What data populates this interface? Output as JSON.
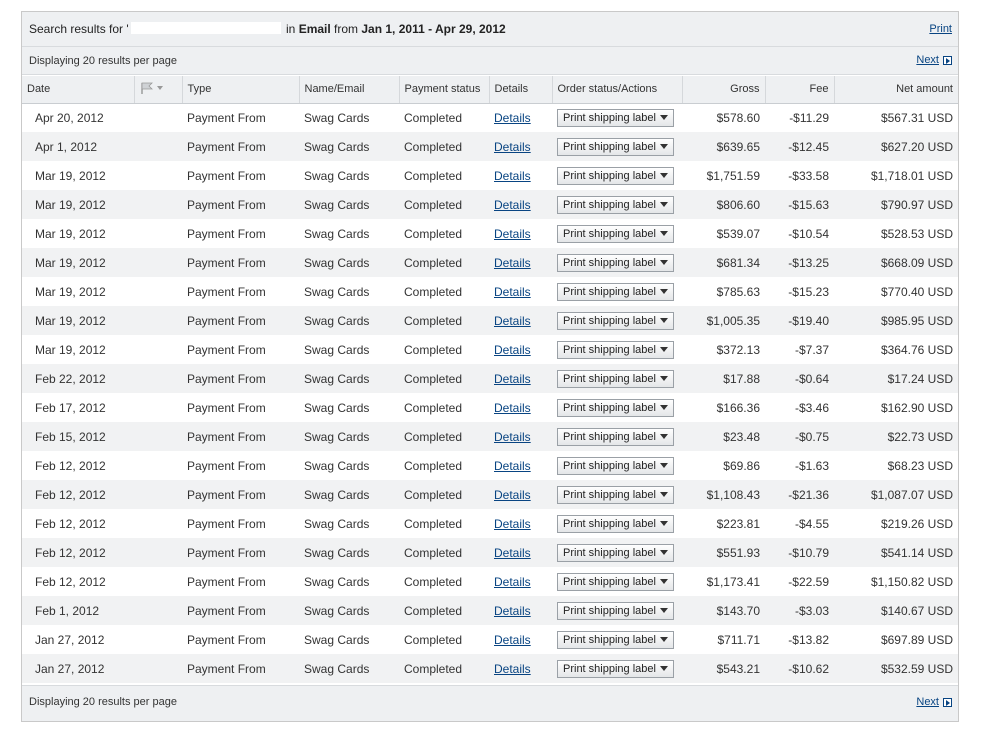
{
  "search": {
    "prefix": "Search results for '",
    "in_text": " in ",
    "field": "Email",
    "from_text": " from ",
    "date_range": "Jan 1, 2011 - Apr 29, 2012"
  },
  "header": {
    "print_label": "Print"
  },
  "pager": {
    "display_text": "Displaying 20 results per page",
    "next_label": "Next"
  },
  "columns": {
    "date": "Date",
    "type": "Type",
    "name_email": "Name/Email",
    "payment_status": "Payment status",
    "details": "Details",
    "order_status": "Order status/Actions",
    "gross": "Gross",
    "fee": "Fee",
    "net": "Net amount"
  },
  "colors": {
    "link": "#084482",
    "header_bg": "#eef0f2",
    "row_alt": "#f1f2f3"
  },
  "icons": {
    "flag_filter": "flag-icon",
    "dropdown": "chevron-down-icon",
    "next": "next-arrow-icon"
  },
  "rows": [
    {
      "date": "Apr 20, 2012",
      "type": "Payment From",
      "name": "Swag Cards",
      "status": "Completed",
      "details": "Details",
      "action": "Print shipping label",
      "gross": "$578.60",
      "fee": "-$11.29",
      "net": "$567.31 USD"
    },
    {
      "date": "Apr 1, 2012",
      "type": "Payment From",
      "name": "Swag Cards",
      "status": "Completed",
      "details": "Details",
      "action": "Print shipping label",
      "gross": "$639.65",
      "fee": "-$12.45",
      "net": "$627.20 USD"
    },
    {
      "date": "Mar 19, 2012",
      "type": "Payment From",
      "name": "Swag Cards",
      "status": "Completed",
      "details": "Details",
      "action": "Print shipping label",
      "gross": "$1,751.59",
      "fee": "-$33.58",
      "net": "$1,718.01 USD"
    },
    {
      "date": "Mar 19, 2012",
      "type": "Payment From",
      "name": "Swag Cards",
      "status": "Completed",
      "details": "Details",
      "action": "Print shipping label",
      "gross": "$806.60",
      "fee": "-$15.63",
      "net": "$790.97 USD"
    },
    {
      "date": "Mar 19, 2012",
      "type": "Payment From",
      "name": "Swag Cards",
      "status": "Completed",
      "details": "Details",
      "action": "Print shipping label",
      "gross": "$539.07",
      "fee": "-$10.54",
      "net": "$528.53 USD"
    },
    {
      "date": "Mar 19, 2012",
      "type": "Payment From",
      "name": "Swag Cards",
      "status": "Completed",
      "details": "Details",
      "action": "Print shipping label",
      "gross": "$681.34",
      "fee": "-$13.25",
      "net": "$668.09 USD"
    },
    {
      "date": "Mar 19, 2012",
      "type": "Payment From",
      "name": "Swag Cards",
      "status": "Completed",
      "details": "Details",
      "action": "Print shipping label",
      "gross": "$785.63",
      "fee": "-$15.23",
      "net": "$770.40 USD"
    },
    {
      "date": "Mar 19, 2012",
      "type": "Payment From",
      "name": "Swag Cards",
      "status": "Completed",
      "details": "Details",
      "action": "Print shipping label",
      "gross": "$1,005.35",
      "fee": "-$19.40",
      "net": "$985.95 USD"
    },
    {
      "date": "Mar 19, 2012",
      "type": "Payment From",
      "name": "Swag Cards",
      "status": "Completed",
      "details": "Details",
      "action": "Print shipping label",
      "gross": "$372.13",
      "fee": "-$7.37",
      "net": "$364.76 USD"
    },
    {
      "date": "Feb 22, 2012",
      "type": "Payment From",
      "name": "Swag Cards",
      "status": "Completed",
      "details": "Details",
      "action": "Print shipping label",
      "gross": "$17.88",
      "fee": "-$0.64",
      "net": "$17.24 USD"
    },
    {
      "date": "Feb 17, 2012",
      "type": "Payment From",
      "name": "Swag Cards",
      "status": "Completed",
      "details": "Details",
      "action": "Print shipping label",
      "gross": "$166.36",
      "fee": "-$3.46",
      "net": "$162.90 USD"
    },
    {
      "date": "Feb 15, 2012",
      "type": "Payment From",
      "name": "Swag Cards",
      "status": "Completed",
      "details": "Details",
      "action": "Print shipping label",
      "gross": "$23.48",
      "fee": "-$0.75",
      "net": "$22.73 USD"
    },
    {
      "date": "Feb 12, 2012",
      "type": "Payment From",
      "name": "Swag Cards",
      "status": "Completed",
      "details": "Details",
      "action": "Print shipping label",
      "gross": "$69.86",
      "fee": "-$1.63",
      "net": "$68.23 USD"
    },
    {
      "date": "Feb 12, 2012",
      "type": "Payment From",
      "name": "Swag Cards",
      "status": "Completed",
      "details": "Details",
      "action": "Print shipping label",
      "gross": "$1,108.43",
      "fee": "-$21.36",
      "net": "$1,087.07 USD"
    },
    {
      "date": "Feb 12, 2012",
      "type": "Payment From",
      "name": "Swag Cards",
      "status": "Completed",
      "details": "Details",
      "action": "Print shipping label",
      "gross": "$223.81",
      "fee": "-$4.55",
      "net": "$219.26 USD"
    },
    {
      "date": "Feb 12, 2012",
      "type": "Payment From",
      "name": "Swag Cards",
      "status": "Completed",
      "details": "Details",
      "action": "Print shipping label",
      "gross": "$551.93",
      "fee": "-$10.79",
      "net": "$541.14 USD"
    },
    {
      "date": "Feb 12, 2012",
      "type": "Payment From",
      "name": "Swag Cards",
      "status": "Completed",
      "details": "Details",
      "action": "Print shipping label",
      "gross": "$1,173.41",
      "fee": "-$22.59",
      "net": "$1,150.82 USD"
    },
    {
      "date": "Feb 1, 2012",
      "type": "Payment From",
      "name": "Swag Cards",
      "status": "Completed",
      "details": "Details",
      "action": "Print shipping label",
      "gross": "$143.70",
      "fee": "-$3.03",
      "net": "$140.67 USD"
    },
    {
      "date": "Jan 27, 2012",
      "type": "Payment From",
      "name": "Swag Cards",
      "status": "Completed",
      "details": "Details",
      "action": "Print shipping label",
      "gross": "$711.71",
      "fee": "-$13.82",
      "net": "$697.89 USD"
    },
    {
      "date": "Jan 27, 2012",
      "type": "Payment From",
      "name": "Swag Cards",
      "status": "Completed",
      "details": "Details",
      "action": "Print shipping label",
      "gross": "$543.21",
      "fee": "-$10.62",
      "net": "$532.59 USD"
    }
  ]
}
